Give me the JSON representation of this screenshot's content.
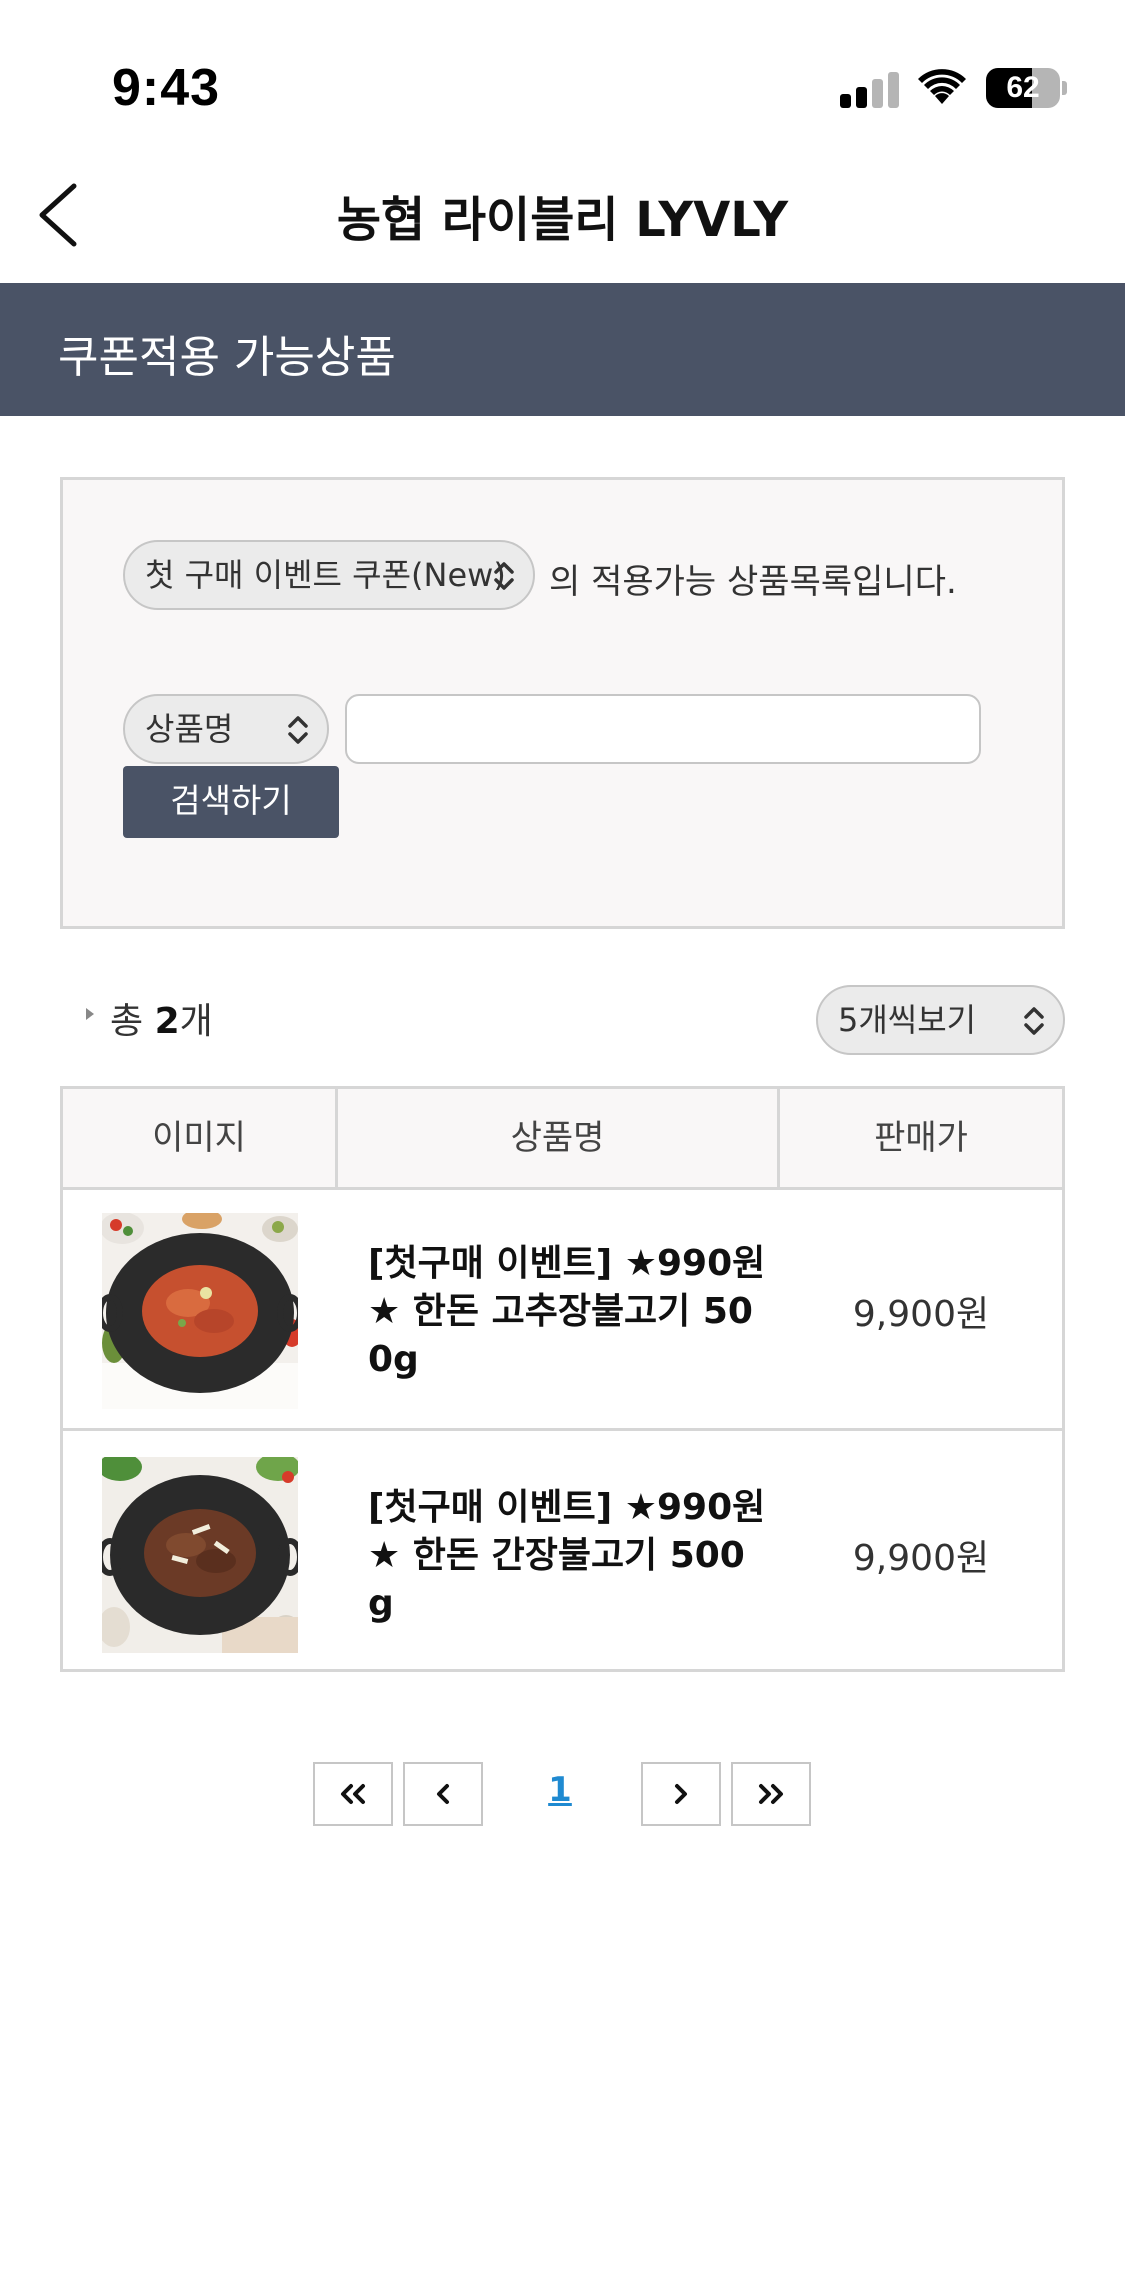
{
  "status_bar": {
    "time": "9:43",
    "battery_percent": "62",
    "battery_level": 0.62,
    "icons": [
      "signal-icon",
      "wifi-icon",
      "battery-icon"
    ]
  },
  "nav": {
    "title": "농협 라이블리 LYVLY",
    "back_icon": "chevron-left-icon"
  },
  "section": {
    "title": "쿠폰적용 가능상품"
  },
  "search": {
    "coupon_select": "첫 구매 이벤트 쿠폰(New)",
    "description": "의 적용가능 상품목록입니다.",
    "field_select": "상품명",
    "input_value": "",
    "button_label": "검색하기"
  },
  "summary": {
    "total_prefix": "총 ",
    "total_count": "2",
    "total_suffix": "개",
    "per_page_select": "5개씩보기"
  },
  "table": {
    "headers": {
      "image": "이미지",
      "name": "상품명",
      "price": "판매가"
    },
    "rows": [
      {
        "name": "[첫구매 이벤트] ★990원★ 한돈 고추장불고기 500g",
        "price": "9,900원"
      },
      {
        "name": "[첫구매 이벤트] ★990원★ 한돈 간장불고기 500g",
        "price": "9,900원"
      }
    ]
  },
  "pagination": {
    "current_page": "1",
    "icons": [
      "first-page-icon",
      "prev-page-icon",
      "next-page-icon",
      "last-page-icon"
    ]
  },
  "colors": {
    "header_bg": "#4a5366",
    "link_blue": "#1f8ad1",
    "box_bg": "#f9f7f7",
    "border": "#d6d6d6"
  }
}
